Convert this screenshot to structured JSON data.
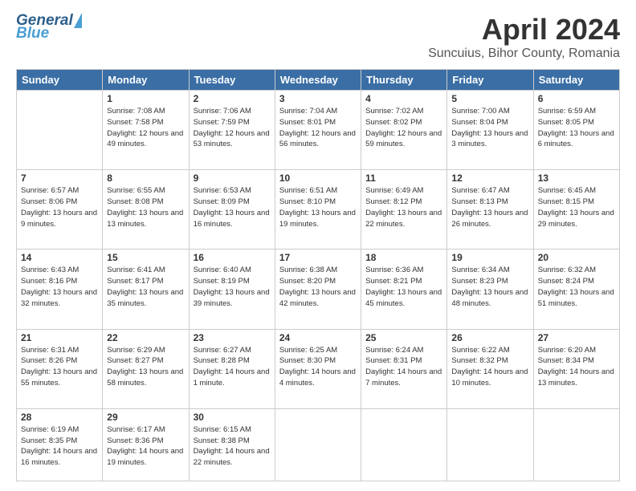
{
  "header": {
    "logo_general": "General",
    "logo_blue": "Blue",
    "title": "April 2024",
    "subtitle": "Suncuius, Bihor County, Romania"
  },
  "calendar": {
    "days_of_week": [
      "Sunday",
      "Monday",
      "Tuesday",
      "Wednesday",
      "Thursday",
      "Friday",
      "Saturday"
    ],
    "weeks": [
      [
        {
          "num": "",
          "sunrise": "",
          "sunset": "",
          "daylight": "",
          "empty": true
        },
        {
          "num": "1",
          "sunrise": "Sunrise: 7:08 AM",
          "sunset": "Sunset: 7:58 PM",
          "daylight": "Daylight: 12 hours and 49 minutes."
        },
        {
          "num": "2",
          "sunrise": "Sunrise: 7:06 AM",
          "sunset": "Sunset: 7:59 PM",
          "daylight": "Daylight: 12 hours and 53 minutes."
        },
        {
          "num": "3",
          "sunrise": "Sunrise: 7:04 AM",
          "sunset": "Sunset: 8:01 PM",
          "daylight": "Daylight: 12 hours and 56 minutes."
        },
        {
          "num": "4",
          "sunrise": "Sunrise: 7:02 AM",
          "sunset": "Sunset: 8:02 PM",
          "daylight": "Daylight: 12 hours and 59 minutes."
        },
        {
          "num": "5",
          "sunrise": "Sunrise: 7:00 AM",
          "sunset": "Sunset: 8:04 PM",
          "daylight": "Daylight: 13 hours and 3 minutes."
        },
        {
          "num": "6",
          "sunrise": "Sunrise: 6:59 AM",
          "sunset": "Sunset: 8:05 PM",
          "daylight": "Daylight: 13 hours and 6 minutes."
        }
      ],
      [
        {
          "num": "7",
          "sunrise": "Sunrise: 6:57 AM",
          "sunset": "Sunset: 8:06 PM",
          "daylight": "Daylight: 13 hours and 9 minutes."
        },
        {
          "num": "8",
          "sunrise": "Sunrise: 6:55 AM",
          "sunset": "Sunset: 8:08 PM",
          "daylight": "Daylight: 13 hours and 13 minutes."
        },
        {
          "num": "9",
          "sunrise": "Sunrise: 6:53 AM",
          "sunset": "Sunset: 8:09 PM",
          "daylight": "Daylight: 13 hours and 16 minutes."
        },
        {
          "num": "10",
          "sunrise": "Sunrise: 6:51 AM",
          "sunset": "Sunset: 8:10 PM",
          "daylight": "Daylight: 13 hours and 19 minutes."
        },
        {
          "num": "11",
          "sunrise": "Sunrise: 6:49 AM",
          "sunset": "Sunset: 8:12 PM",
          "daylight": "Daylight: 13 hours and 22 minutes."
        },
        {
          "num": "12",
          "sunrise": "Sunrise: 6:47 AM",
          "sunset": "Sunset: 8:13 PM",
          "daylight": "Daylight: 13 hours and 26 minutes."
        },
        {
          "num": "13",
          "sunrise": "Sunrise: 6:45 AM",
          "sunset": "Sunset: 8:15 PM",
          "daylight": "Daylight: 13 hours and 29 minutes."
        }
      ],
      [
        {
          "num": "14",
          "sunrise": "Sunrise: 6:43 AM",
          "sunset": "Sunset: 8:16 PM",
          "daylight": "Daylight: 13 hours and 32 minutes."
        },
        {
          "num": "15",
          "sunrise": "Sunrise: 6:41 AM",
          "sunset": "Sunset: 8:17 PM",
          "daylight": "Daylight: 13 hours and 35 minutes."
        },
        {
          "num": "16",
          "sunrise": "Sunrise: 6:40 AM",
          "sunset": "Sunset: 8:19 PM",
          "daylight": "Daylight: 13 hours and 39 minutes."
        },
        {
          "num": "17",
          "sunrise": "Sunrise: 6:38 AM",
          "sunset": "Sunset: 8:20 PM",
          "daylight": "Daylight: 13 hours and 42 minutes."
        },
        {
          "num": "18",
          "sunrise": "Sunrise: 6:36 AM",
          "sunset": "Sunset: 8:21 PM",
          "daylight": "Daylight: 13 hours and 45 minutes."
        },
        {
          "num": "19",
          "sunrise": "Sunrise: 6:34 AM",
          "sunset": "Sunset: 8:23 PM",
          "daylight": "Daylight: 13 hours and 48 minutes."
        },
        {
          "num": "20",
          "sunrise": "Sunrise: 6:32 AM",
          "sunset": "Sunset: 8:24 PM",
          "daylight": "Daylight: 13 hours and 51 minutes."
        }
      ],
      [
        {
          "num": "21",
          "sunrise": "Sunrise: 6:31 AM",
          "sunset": "Sunset: 8:26 PM",
          "daylight": "Daylight: 13 hours and 55 minutes."
        },
        {
          "num": "22",
          "sunrise": "Sunrise: 6:29 AM",
          "sunset": "Sunset: 8:27 PM",
          "daylight": "Daylight: 13 hours and 58 minutes."
        },
        {
          "num": "23",
          "sunrise": "Sunrise: 6:27 AM",
          "sunset": "Sunset: 8:28 PM",
          "daylight": "Daylight: 14 hours and 1 minute."
        },
        {
          "num": "24",
          "sunrise": "Sunrise: 6:25 AM",
          "sunset": "Sunset: 8:30 PM",
          "daylight": "Daylight: 14 hours and 4 minutes."
        },
        {
          "num": "25",
          "sunrise": "Sunrise: 6:24 AM",
          "sunset": "Sunset: 8:31 PM",
          "daylight": "Daylight: 14 hours and 7 minutes."
        },
        {
          "num": "26",
          "sunrise": "Sunrise: 6:22 AM",
          "sunset": "Sunset: 8:32 PM",
          "daylight": "Daylight: 14 hours and 10 minutes."
        },
        {
          "num": "27",
          "sunrise": "Sunrise: 6:20 AM",
          "sunset": "Sunset: 8:34 PM",
          "daylight": "Daylight: 14 hours and 13 minutes."
        }
      ],
      [
        {
          "num": "28",
          "sunrise": "Sunrise: 6:19 AM",
          "sunset": "Sunset: 8:35 PM",
          "daylight": "Daylight: 14 hours and 16 minutes."
        },
        {
          "num": "29",
          "sunrise": "Sunrise: 6:17 AM",
          "sunset": "Sunset: 8:36 PM",
          "daylight": "Daylight: 14 hours and 19 minutes."
        },
        {
          "num": "30",
          "sunrise": "Sunrise: 6:15 AM",
          "sunset": "Sunset: 8:38 PM",
          "daylight": "Daylight: 14 hours and 22 minutes."
        },
        {
          "num": "",
          "sunrise": "",
          "sunset": "",
          "daylight": "",
          "empty": true
        },
        {
          "num": "",
          "sunrise": "",
          "sunset": "",
          "daylight": "",
          "empty": true
        },
        {
          "num": "",
          "sunrise": "",
          "sunset": "",
          "daylight": "",
          "empty": true
        },
        {
          "num": "",
          "sunrise": "",
          "sunset": "",
          "daylight": "",
          "empty": true
        }
      ]
    ]
  }
}
